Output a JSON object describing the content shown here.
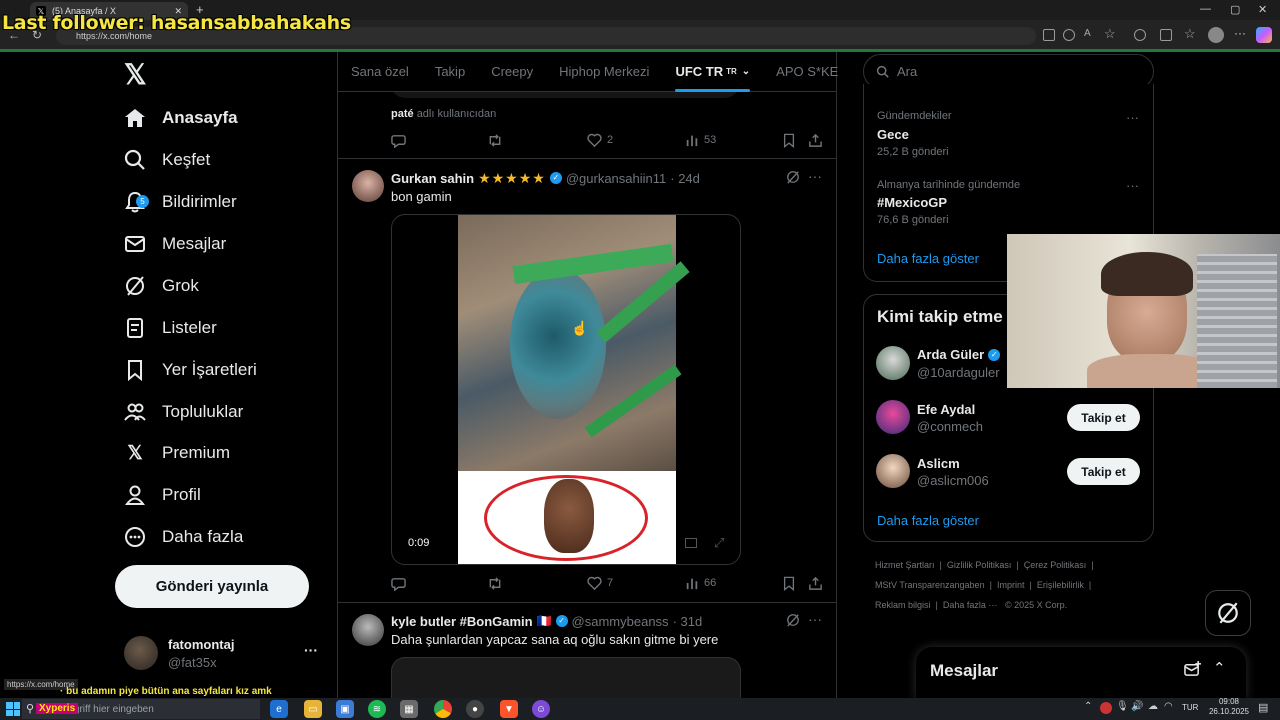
{
  "overlay": {
    "title": "Last follower: hasansabbahakahs"
  },
  "browser": {
    "tab_title": "(5) Anasayfa / X",
    "url": "https://x.com/home",
    "status_url": "https://x.com/home"
  },
  "nav": {
    "items": [
      {
        "label": "Anasayfa",
        "icon": "home-icon"
      },
      {
        "label": "Keşfet",
        "icon": "search-icon"
      },
      {
        "label": "Bildirimler",
        "icon": "bell-icon",
        "badge": "5"
      },
      {
        "label": "Mesajlar",
        "icon": "mail-icon"
      },
      {
        "label": "Grok",
        "icon": "grok-icon"
      },
      {
        "label": "Listeler",
        "icon": "list-icon"
      },
      {
        "label": "Yer İşaretleri",
        "icon": "bookmark-icon"
      },
      {
        "label": "Topluluklar",
        "icon": "people-icon"
      },
      {
        "label": "Premium",
        "icon": "x-icon"
      },
      {
        "label": "Profil",
        "icon": "person-icon"
      },
      {
        "label": "Daha fazla",
        "icon": "more-circle-icon"
      }
    ],
    "post_button": "Gönderi yayınla",
    "account": {
      "name": "fatomontaj",
      "handle": "@fat35x",
      "more": "···"
    }
  },
  "feed_tabs": [
    "Sana özel",
    "Takip",
    "Creepy",
    "Hiphop Merkezi",
    "UFC TR",
    "APO S*KE"
  ],
  "feed_tabs_active_flag": "TR",
  "tweets": [
    {
      "partial_caption_user": "paté",
      "partial_caption_rest": "adlı kullanıcıdan",
      "likes": "2",
      "views": "53"
    },
    {
      "name": "Gurkan sahin",
      "stars": "★★★★★",
      "handle": "@gurkansahiin11",
      "time": "· 24d",
      "text": "bon gamin",
      "video_time": "0:09",
      "likes": "7",
      "views": "66"
    },
    {
      "name": "kyle butler #BonGamin",
      "flag": "🇫🇷",
      "handle": "@sammybeanss",
      "time": "· 31d",
      "text": "Daha şunlardan yapcaz sana aq oğlu sakın gitme bi yere"
    }
  ],
  "search": {
    "placeholder": "Ara"
  },
  "trends": [
    {
      "context": "Gündemdekiler",
      "topic": "Gece",
      "count": "25,2 B gönderi"
    },
    {
      "context": "Almanya tarihinde gündemde",
      "topic": "#MexicoGP",
      "count": "76,6 B gönderi"
    }
  ],
  "trends_more": "Daha fazla göster",
  "who_to_follow": {
    "title": "Kimi takip etme",
    "accounts": [
      {
        "name": "Arda Güler",
        "handle": "@10ardaguler"
      },
      {
        "name": "Efe Aydal",
        "handle": "@conmech",
        "button": "Takip et"
      },
      {
        "name": "Aslicm",
        "handle": "@aslicm006",
        "button": "Takip et"
      }
    ],
    "more": "Daha fazla göster"
  },
  "footer_links": [
    "Hizmet Şartları",
    "|",
    "Gizlilik Politikası",
    "|",
    "Çerez Politikası",
    "|",
    "MStV Transparenzangaben",
    "|",
    "Imprint",
    "|",
    "Erişilebilirlik",
    "|",
    "Reklam bilgisi",
    "|",
    "Daha fazla ···",
    "© 2025 X Corp."
  ],
  "messages_drawer": {
    "title": "Mesajlar"
  },
  "ticker": {
    "text": "· bu adamın piye bütün ana sayfaları kız amk",
    "brand": "Xyperis"
  },
  "taskbar": {
    "search_placeholder": "Suchbegriff hier eingeben",
    "lang": "TUR",
    "time": "09:08",
    "date": "26.10.2025"
  },
  "colors": {
    "accent": "#1d9bf0",
    "overlay": "#f5e642",
    "background": "#000000"
  }
}
